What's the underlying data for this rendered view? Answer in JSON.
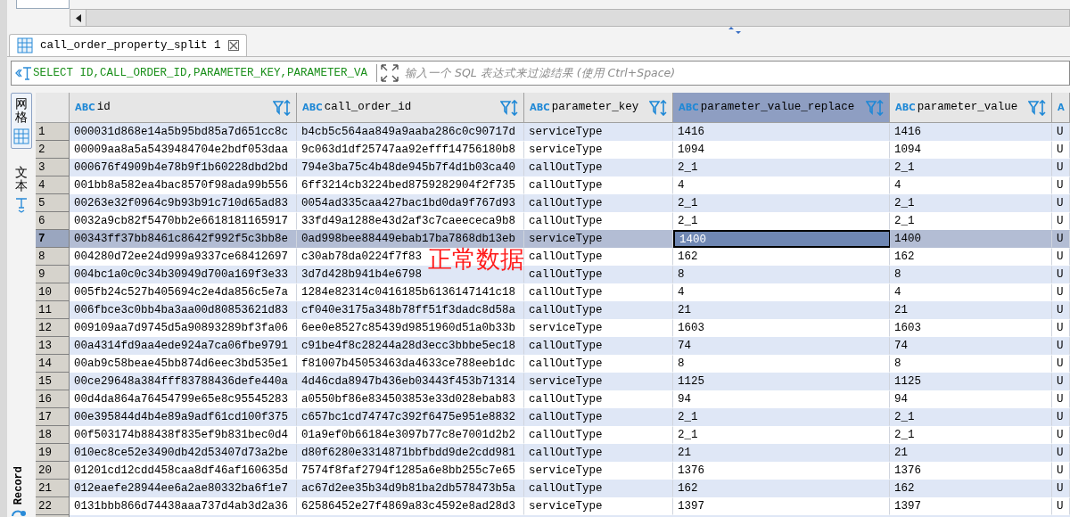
{
  "result_tab": {
    "title": "call_order_property_split 1"
  },
  "filter": {
    "value": "SELECT ID,CALL_ORDER_ID,PARAMETER_KEY,PARAMETER_VA",
    "placeholder": "输入一个 SQL 表达式来过滤结果 (使用 Ctrl+Space)"
  },
  "side_panel": {
    "tabs": [
      {
        "label": "网格",
        "selected": true
      },
      {
        "label": "文本",
        "selected": false
      }
    ],
    "record_label": "Record"
  },
  "annotation": "正常数据",
  "grid": {
    "columns": [
      {
        "type": "ABC",
        "name": "id",
        "selected": false
      },
      {
        "type": "ABC",
        "name": "call_order_id",
        "selected": false
      },
      {
        "type": "ABC",
        "name": "parameter_key",
        "selected": false
      },
      {
        "type": "ABC",
        "name": "parameter_value_replace",
        "selected": true
      },
      {
        "type": "ABC",
        "name": "parameter_value",
        "selected": false
      },
      {
        "type": "A",
        "selected": false
      }
    ],
    "rows": [
      {
        "number": "1",
        "selected": false,
        "cells": [
          "000031d868e14a5b95bd85a7d651cc8c",
          "b4cb5c564aa849a9aaba286c0c90717d",
          "serviceType",
          "1416",
          "1416",
          "U"
        ]
      },
      {
        "number": "2",
        "selected": false,
        "cells": [
          "00009aa8a5a5439484704e2bdf053daa",
          "9c063d1df25747aa92efff14756180b8",
          "serviceType",
          "1094",
          "1094",
          "U"
        ]
      },
      {
        "number": "3",
        "selected": false,
        "cells": [
          "000676f4909b4e78b9f1b60228dbd2bd",
          "794e3ba75c4b48de945b7f4d1b03ca40",
          "callOutType",
          "2_1",
          "2_1",
          "U"
        ]
      },
      {
        "number": "4",
        "selected": false,
        "cells": [
          "001bb8a582ea4bac8570f98ada99b556",
          "6ff3214cb3224bed8759282904f2f735",
          "callOutType",
          "4",
          "4",
          "U"
        ]
      },
      {
        "number": "5",
        "selected": false,
        "cells": [
          "00263e32f0964c9b93b91c710d65ad83",
          "0054ad335caa427bac1bd0da9f767d93",
          "callOutType",
          "2_1",
          "2_1",
          "U"
        ]
      },
      {
        "number": "6",
        "selected": false,
        "cells": [
          "0032a9cb82f5470bb2e6618181165917",
          "33fd49a1288e43d2af3c7caeececa9b8",
          "callOutType",
          "2_1",
          "2_1",
          "U"
        ]
      },
      {
        "number": "7",
        "selected": true,
        "cells": [
          "00343ff37bb8461c8642f992f5c3bb8e",
          "0ad998bee88449ebab17ba7868db13eb",
          "serviceType",
          "1400",
          "1400",
          "U"
        ]
      },
      {
        "number": "8",
        "selected": false,
        "cells": [
          "004280d72ee24d999a9337ce68412697",
          "c30ab78da0224f7f83",
          "callOutType",
          "162",
          "162",
          "U"
        ]
      },
      {
        "number": "9",
        "selected": false,
        "cells": [
          "004bc1a0c0c34b30949d700a169f3e33",
          "3d7d428b941b4e6798",
          "callOutType",
          "8",
          "8",
          "U"
        ]
      },
      {
        "number": "10",
        "selected": false,
        "cells": [
          "005fb24c527b405694c2e4da856c5e7a",
          "1284e82314c0416185b6136147141c18",
          "callOutType",
          "4",
          "4",
          "U"
        ]
      },
      {
        "number": "11",
        "selected": false,
        "cells": [
          "006fbce3c0bb4ba3aa00d80853621d83",
          "cf040e3175a348b78ff51f3dadc8d58a",
          "callOutType",
          "21",
          "21",
          "U"
        ]
      },
      {
        "number": "12",
        "selected": false,
        "cells": [
          "009109aa7d9745d5a90893289bf3fa06",
          "6ee0e8527c85439d9851960d51a0b33b",
          "serviceType",
          "1603",
          "1603",
          "U"
        ]
      },
      {
        "number": "13",
        "selected": false,
        "cells": [
          "00a4314fd9aa4ede924a7ca06fbe9791",
          "c91be4f8c28244a28d3ecc3bbbe5ec18",
          "callOutType",
          "74",
          "74",
          "U"
        ]
      },
      {
        "number": "14",
        "selected": false,
        "cells": [
          "00ab9c58beae45bb874d6eec3bd535e1",
          "f81007b45053463da4633ce788eeb1dc",
          "callOutType",
          "8",
          "8",
          "U"
        ]
      },
      {
        "number": "15",
        "selected": false,
        "cells": [
          "00ce29648a384fff83788436defe440a",
          "4d46cda8947b436eb03443f453b71314",
          "serviceType",
          "1125",
          "1125",
          "U"
        ]
      },
      {
        "number": "16",
        "selected": false,
        "cells": [
          "00d4da864a76454799e65e8c95545283",
          "a0550bf86e834503853e33d028ebab83",
          "callOutType",
          "94",
          "94",
          "U"
        ]
      },
      {
        "number": "17",
        "selected": false,
        "cells": [
          "00e395844d4b4e89a9adf61cd100f375",
          "c657bc1cd74747c392f6475e951e8832",
          "callOutType",
          "2_1",
          "2_1",
          "U"
        ]
      },
      {
        "number": "18",
        "selected": false,
        "cells": [
          "00f503174b88438f835ef9b831bec0d4",
          "01a9ef0b66184e3097b77c8e7001d2b2",
          "callOutType",
          "2_1",
          "2_1",
          "U"
        ]
      },
      {
        "number": "19",
        "selected": false,
        "cells": [
          "010ec8ce52e3490db42d53407d73a2be",
          "d80f6280e3314871bbfbdd9de2cdd981",
          "callOutType",
          "21",
          "21",
          "U"
        ]
      },
      {
        "number": "20",
        "selected": false,
        "cells": [
          "01201cd12cdd458caa8df46af160635d",
          "7574f8faf2794f1285a6e8bb255c7e65",
          "serviceType",
          "1376",
          "1376",
          "U"
        ]
      },
      {
        "number": "21",
        "selected": false,
        "cells": [
          "012eaefe28944ee6a2ae80332ba6f1e7",
          "ac67d2ee35b34d9b81ba2db578473b5a",
          "callOutType",
          "162",
          "162",
          "U"
        ]
      },
      {
        "number": "22",
        "selected": false,
        "cells": [
          "0131bbb866d74438aaa737d4ab3d2a36",
          "62586452e27f4869a83c4592e8ad28d3",
          "serviceType",
          "1397",
          "1397",
          "U"
        ]
      }
    ]
  }
}
